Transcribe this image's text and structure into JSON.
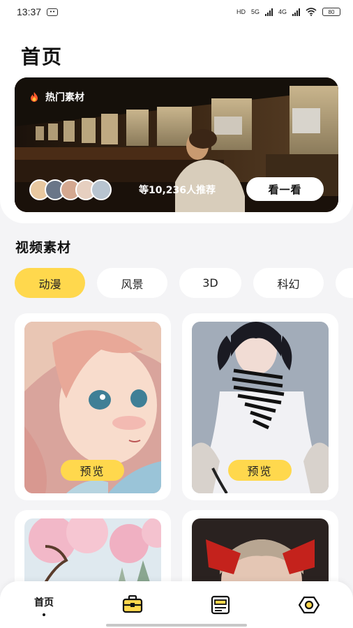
{
  "status_bar": {
    "time": "13:37",
    "right_text": [
      "HD",
      "5G",
      "4G"
    ],
    "battery": "80"
  },
  "page_title": "首页",
  "banner": {
    "tag": "热门素材",
    "recommend_text": "等10,236人推荐",
    "button_label": "看一看",
    "avatar_colors": [
      "#e8c8a0",
      "#6a7688",
      "#d4a890",
      "#e6cfc0",
      "#b8c4d0"
    ]
  },
  "section_title": "视频素材",
  "chips": [
    {
      "label": "动漫",
      "active": true
    },
    {
      "label": "风景",
      "active": false
    },
    {
      "label": "3D",
      "active": false
    },
    {
      "label": "科幻",
      "active": false
    },
    {
      "label": "",
      "active": false
    }
  ],
  "cards": [
    {
      "preview_label": "预览",
      "subject": "anime-girl-portrait"
    },
    {
      "preview_label": "预览",
      "subject": "anime-girl-striped-scarf"
    },
    {
      "subject": "cherry-blossom-landscape"
    },
    {
      "subject": "girl-red-bow"
    }
  ],
  "bottom_nav": {
    "items": [
      {
        "label": "首页",
        "icon": "home",
        "active": true
      },
      {
        "label": "",
        "icon": "briefcase-icon"
      },
      {
        "label": "",
        "icon": "document-icon"
      },
      {
        "label": "",
        "icon": "settings-gear-icon"
      }
    ]
  },
  "colors": {
    "accent": "#ffd84d",
    "background": "#f4f4f6"
  }
}
